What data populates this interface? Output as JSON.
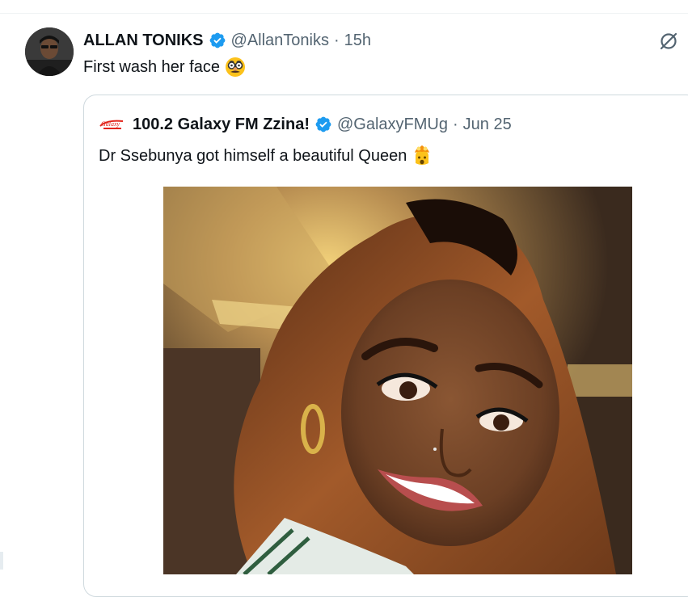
{
  "tweet": {
    "author_name": "ALLAN TONIKS",
    "handle": "@AllanToniks",
    "separator": "·",
    "time": "15h",
    "text": "First wash her face",
    "emoji_icon": "disguised-face-emoji"
  },
  "quote": {
    "author_name": "100.2 Galaxy FM Zzina!",
    "handle": "@GalaxyFMUg",
    "separator": "·",
    "time": "Jun 25",
    "text": "Dr Ssebunya got himself a beautiful Queen",
    "emoji_icon": "exploding-head-emoji",
    "logo_icon": "galaxy-fm-logo"
  },
  "colors": {
    "verified": "#1d9bf0",
    "secondary_text": "#536471",
    "border": "#cfd9de"
  }
}
